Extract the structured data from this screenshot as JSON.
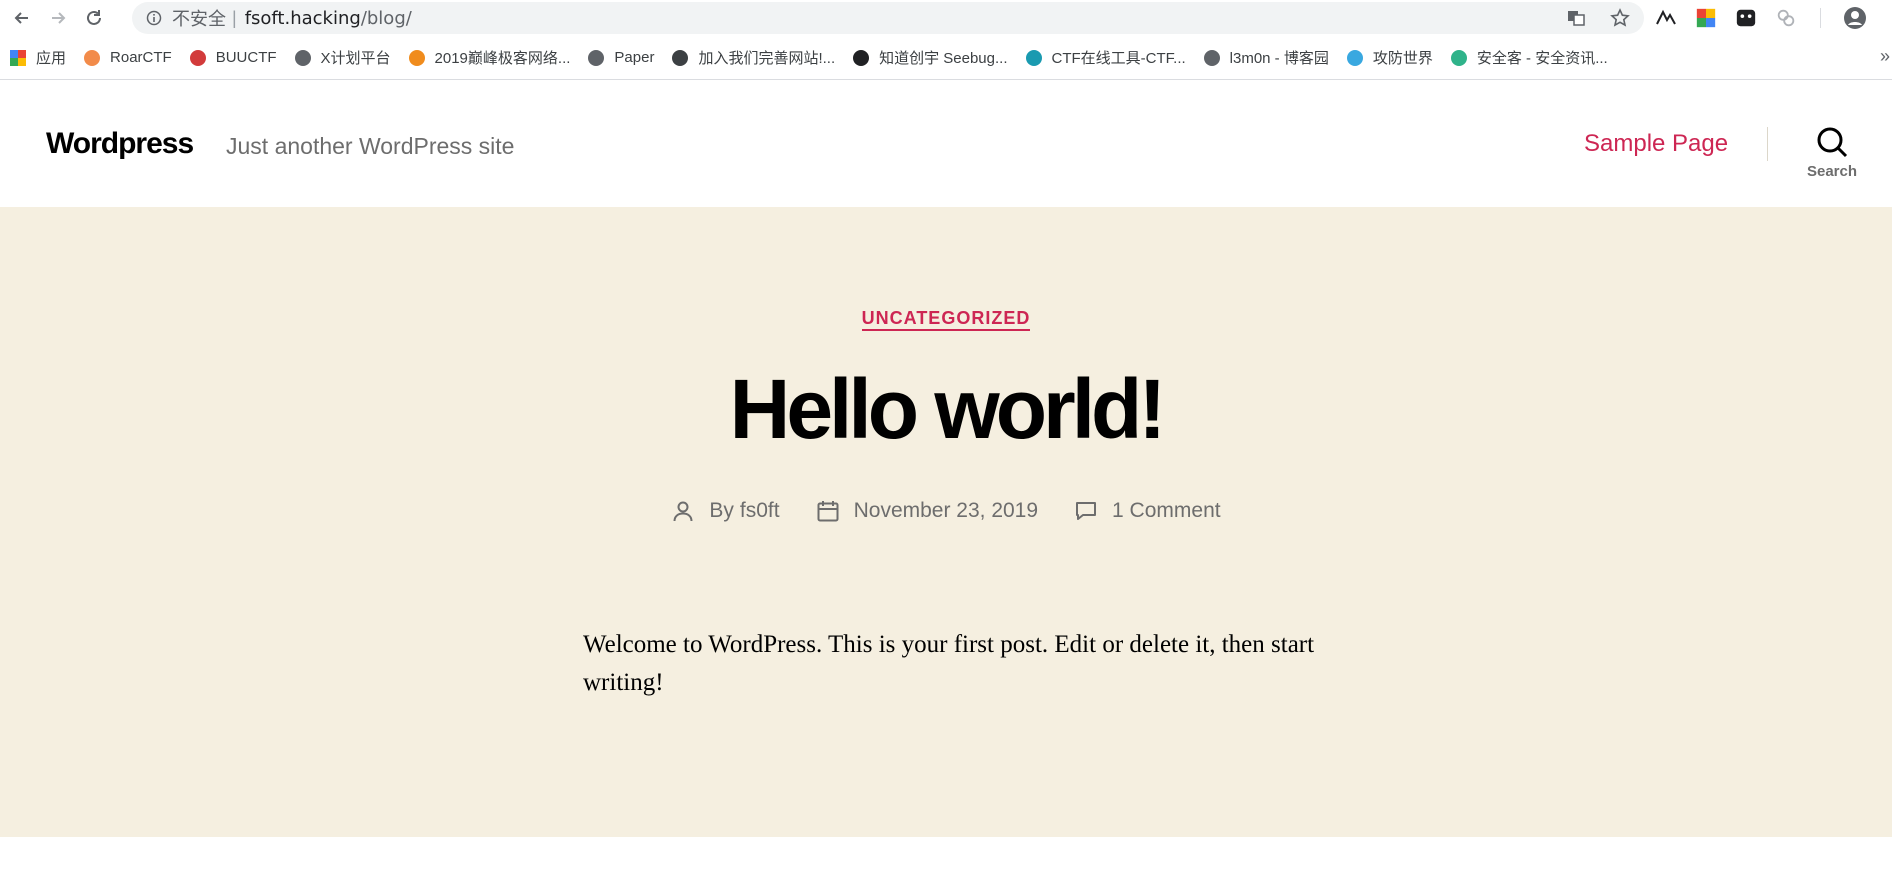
{
  "browser": {
    "address_bar": {
      "security_label": "不安全",
      "url_host": "fsoft.hacking",
      "url_path": "/blog/"
    },
    "bookmarks": [
      {
        "label": "应用",
        "color": "#4285f4"
      },
      {
        "label": "RoarCTF",
        "color": "#f28b4a"
      },
      {
        "label": "BUUCTF",
        "color": "#d23b3b"
      },
      {
        "label": "X计划平台",
        "color": "#5f6368"
      },
      {
        "label": "2019巅峰极客网络...",
        "color": "#f08c1d"
      },
      {
        "label": "Paper",
        "color": "#5f6368"
      },
      {
        "label": "加入我们完善网站!...",
        "color": "#3c4043"
      },
      {
        "label": "知道创宇 Seebug...",
        "color": "#202124"
      },
      {
        "label": "CTF在线工具-CTF...",
        "color": "#1a9ab0"
      },
      {
        "label": "l3m0n - 博客园",
        "color": "#5f6368"
      },
      {
        "label": "攻防世界",
        "color": "#39a8e0"
      },
      {
        "label": "安全客 - 安全资讯...",
        "color": "#2fb38a"
      }
    ],
    "more_bookmarks": "»"
  },
  "site": {
    "title": "Wordpress",
    "description": "Just another WordPress site",
    "menu_item": "Sample Page",
    "search_label": "Search",
    "accent_color": "#cd2653",
    "hero_background": "#f5efe0"
  },
  "post": {
    "category": "UNCATEGORIZED",
    "title": "Hello world!",
    "meta": {
      "author_prefix": "By",
      "author": "fs0ft",
      "date": "November 23, 2019",
      "comments": "1 Comment"
    },
    "body": "Welcome to WordPress. This is your first post. Edit or delete it, then start writing!"
  }
}
